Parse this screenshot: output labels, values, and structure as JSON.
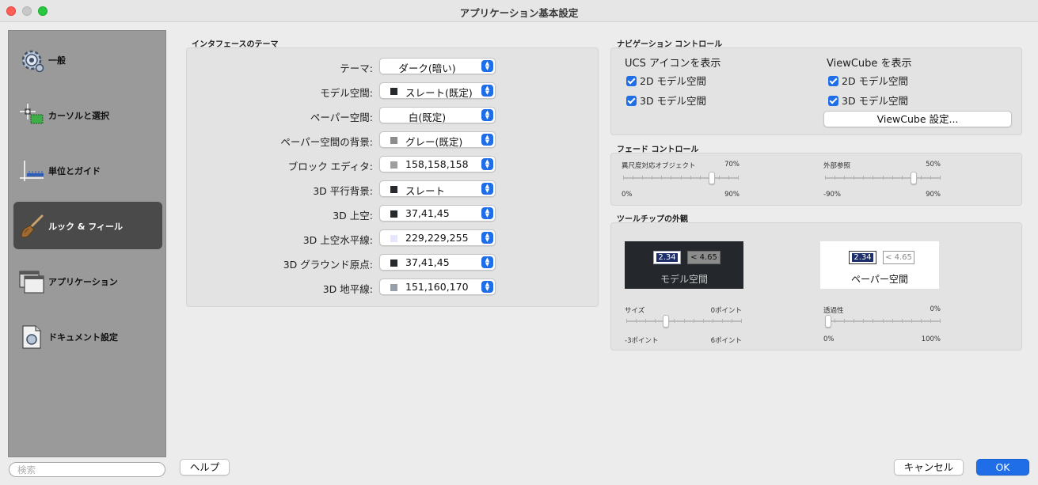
{
  "window": {
    "title": "アプリケーション基本設定"
  },
  "sidebar": {
    "items": [
      {
        "label": "一般",
        "icon": "gear-icon"
      },
      {
        "label": "カーソルと選択",
        "icon": "cursor-select-icon"
      },
      {
        "label": "単位とガイド",
        "icon": "ruler-icon"
      },
      {
        "label": "ルック & フィール",
        "icon": "brush-icon",
        "active": true
      },
      {
        "label": "アプリケーション",
        "icon": "window-icon"
      },
      {
        "label": "ドキュメント設定",
        "icon": "document-icon"
      }
    ],
    "search_placeholder": "検索"
  },
  "interface_theme": {
    "title": "インタフェースのテーマ",
    "rows": [
      {
        "label": "テーマ:",
        "value": "ダーク(暗い)",
        "swatch": null
      },
      {
        "label": "モデル空間:",
        "value": "スレート(既定)",
        "swatch": "#25292e"
      },
      {
        "label": "ペーパー空間:",
        "value": "白(既定)",
        "swatch": null
      },
      {
        "label": "ペーパー空間の背景:",
        "value": "グレー(既定)",
        "swatch": "#8c8c8c"
      },
      {
        "label": "ブロック エディタ:",
        "value": "158,158,158",
        "swatch": "#9e9e9e"
      },
      {
        "label": "3D 平行背景:",
        "value": "スレート",
        "swatch": "#25292e"
      },
      {
        "label": "3D 上空:",
        "value": "37,41,45",
        "swatch": "#25292d"
      },
      {
        "label": "3D 上空水平線:",
        "value": "229,229,255",
        "swatch": "#e5e5ff"
      },
      {
        "label": "3D グラウンド原点:",
        "value": "37,41,45",
        "swatch": "#25292d"
      },
      {
        "label": "3D 地平線:",
        "value": "151,160,170",
        "swatch": "#97a0aa"
      }
    ]
  },
  "navigation": {
    "title": "ナビゲーション コントロール",
    "ucs": {
      "title": "UCS アイコンを表示",
      "items": [
        {
          "label": "2D モデル空間",
          "checked": true
        },
        {
          "label": "3D モデル空間",
          "checked": true
        }
      ]
    },
    "viewcube": {
      "title": "ViewCube を表示",
      "items": [
        {
          "label": "2D モデル空間",
          "checked": true
        },
        {
          "label": "3D モデル空間",
          "checked": true
        }
      ],
      "settings_button": "ViewCube 設定..."
    }
  },
  "fade": {
    "title": "フェード コントロール",
    "annotative": {
      "label": "異尺度対応オブジェクト",
      "value_text": "70%",
      "min": "0%",
      "max": "90%",
      "level": 0.78
    },
    "xref": {
      "label": "外部参照",
      "value_text": "50%",
      "min": "-90%",
      "max": "90%",
      "level": 0.78
    }
  },
  "tooltip": {
    "title": "ツールチップの外観",
    "model_preview": {
      "label": "モデル空間",
      "input": "2.34",
      "hint": "< 4.65"
    },
    "paper_preview": {
      "label": "ペーパー空間",
      "input": "2.34",
      "hint": "< 4.65"
    },
    "size": {
      "label": "サイズ",
      "value_text": "0ポイント",
      "min": "-3ポイント",
      "max": "6ポイント",
      "level": 0.33
    },
    "transparency": {
      "label": "透過性",
      "value_text": "0%",
      "min": "0%",
      "max": "100%",
      "level": 0.0
    }
  },
  "footer": {
    "help": "ヘルプ",
    "cancel": "キャンセル",
    "ok": "OK"
  },
  "colors": {
    "accent": "#1f6ee8",
    "sidebar": "#9a9a9a",
    "sidebar_active": "#4a4a4a"
  }
}
